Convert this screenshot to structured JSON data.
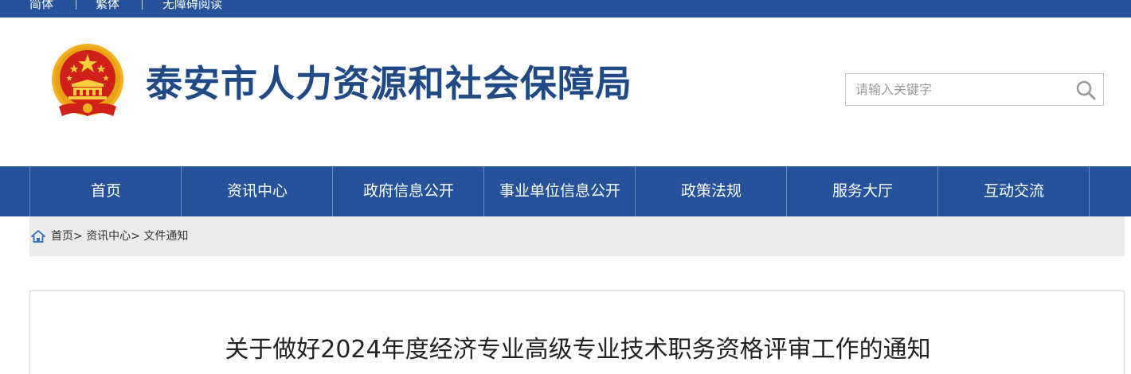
{
  "topbar": {
    "links": [
      {
        "label": "简体"
      },
      {
        "label": "繁体"
      },
      {
        "label": "无障碍阅读"
      }
    ]
  },
  "header": {
    "site_title": "泰安市人力资源和社会保障局",
    "emblem_icon": "national-emblem-icon"
  },
  "search": {
    "placeholder": "请输入关键字",
    "value": "",
    "icon": "search-icon"
  },
  "nav": {
    "items": [
      {
        "label": "首页"
      },
      {
        "label": "资讯中心"
      },
      {
        "label": "政府信息公开"
      },
      {
        "label": "事业单位信息公开"
      },
      {
        "label": "政策法规"
      },
      {
        "label": "服务大厅"
      },
      {
        "label": "互动交流"
      }
    ]
  },
  "breadcrumb": {
    "icon": "home-icon",
    "items": [
      {
        "label": "首页"
      },
      {
        "label": "资讯中心"
      },
      {
        "label": "文件通知"
      }
    ],
    "separator": ">"
  },
  "article": {
    "title": "关于做好2024年度经济专业高级专业技术职务资格评审工作的通知"
  },
  "colors": {
    "primary_blue": "#25529a",
    "title_blue": "#1f4a86",
    "emblem_red": "#d0201a",
    "emblem_gold": "#f2b01e",
    "breadcrumb_bg": "#ebebeb"
  }
}
